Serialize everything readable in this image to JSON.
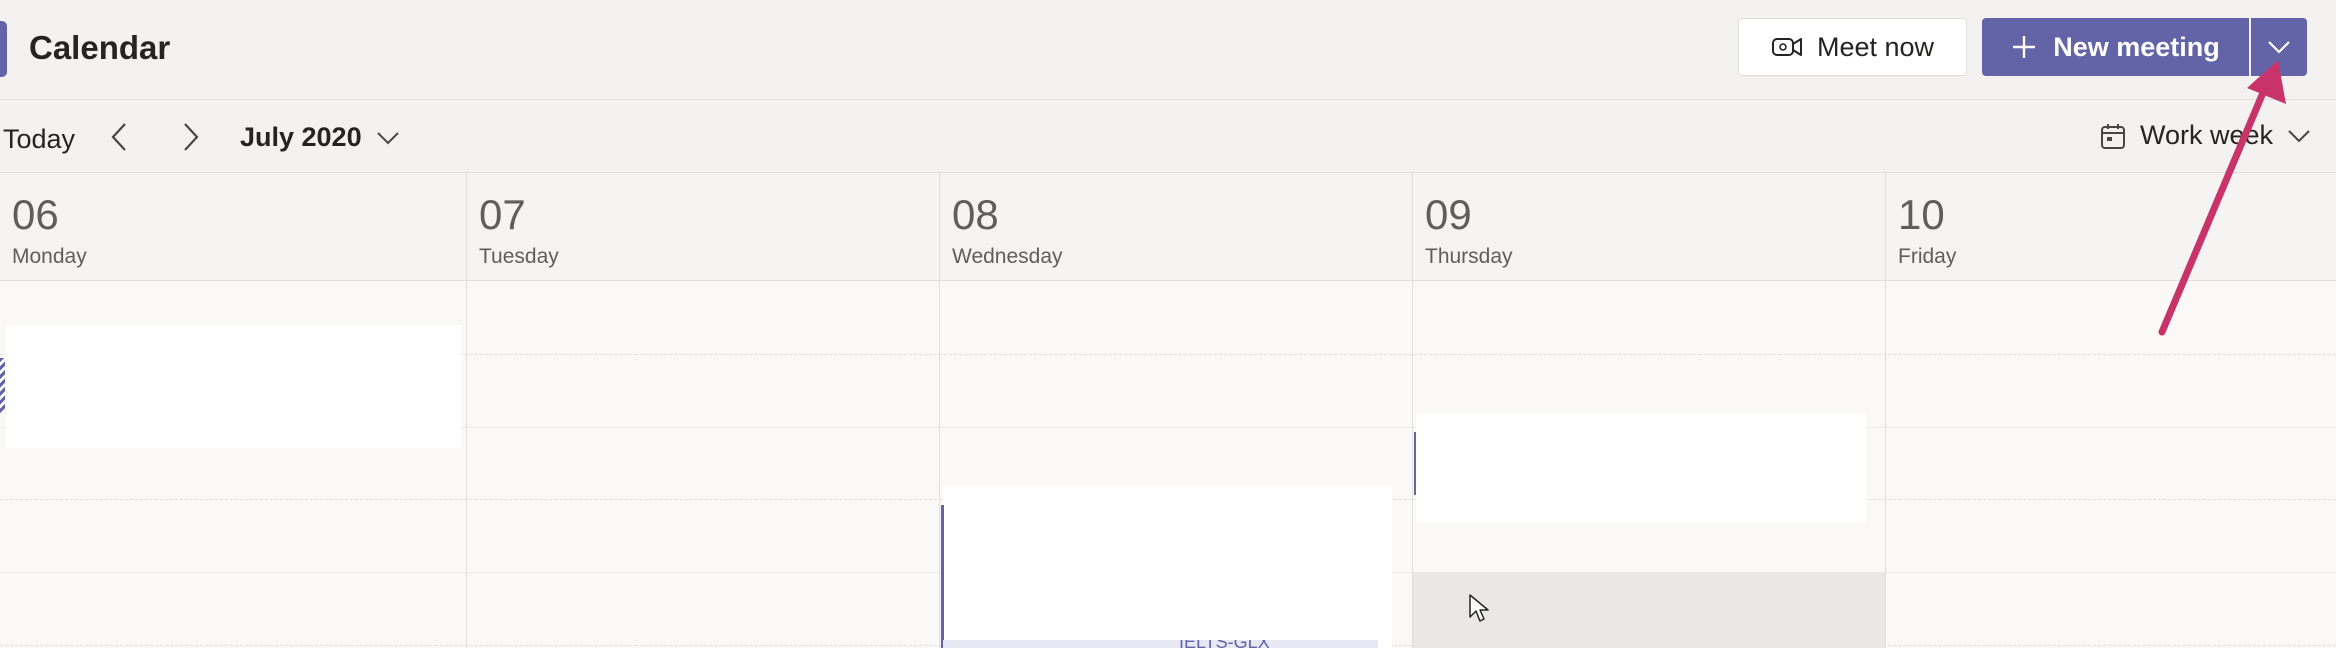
{
  "header": {
    "title": "Calendar",
    "meet_now_label": "Meet now",
    "new_meeting_label": "New meeting"
  },
  "toolbar": {
    "today_label": "Today",
    "month_label": "July 2020",
    "view_label": "Work week"
  },
  "days": [
    {
      "number": "06",
      "name": "Monday"
    },
    {
      "number": "07",
      "name": "Tuesday"
    },
    {
      "number": "08",
      "name": "Wednesday"
    },
    {
      "number": "09",
      "name": "Thursday"
    },
    {
      "number": "10",
      "name": "Friday"
    }
  ],
  "events": {
    "wednesday_strip_text": "IELTS-GLX"
  },
  "icons": {
    "meet_now": "video-camera-icon",
    "new_meeting": "plus-icon",
    "dropdown": "chevron-down-icon",
    "prev": "chevron-left-icon",
    "next": "chevron-right-icon",
    "view": "calendar-icon",
    "annotation": "red-arrow",
    "pointer": "mouse-cursor"
  },
  "colors": {
    "brand": "#6264a7",
    "annotation_arrow": "#c8336a",
    "background": "#f3f2f1"
  }
}
